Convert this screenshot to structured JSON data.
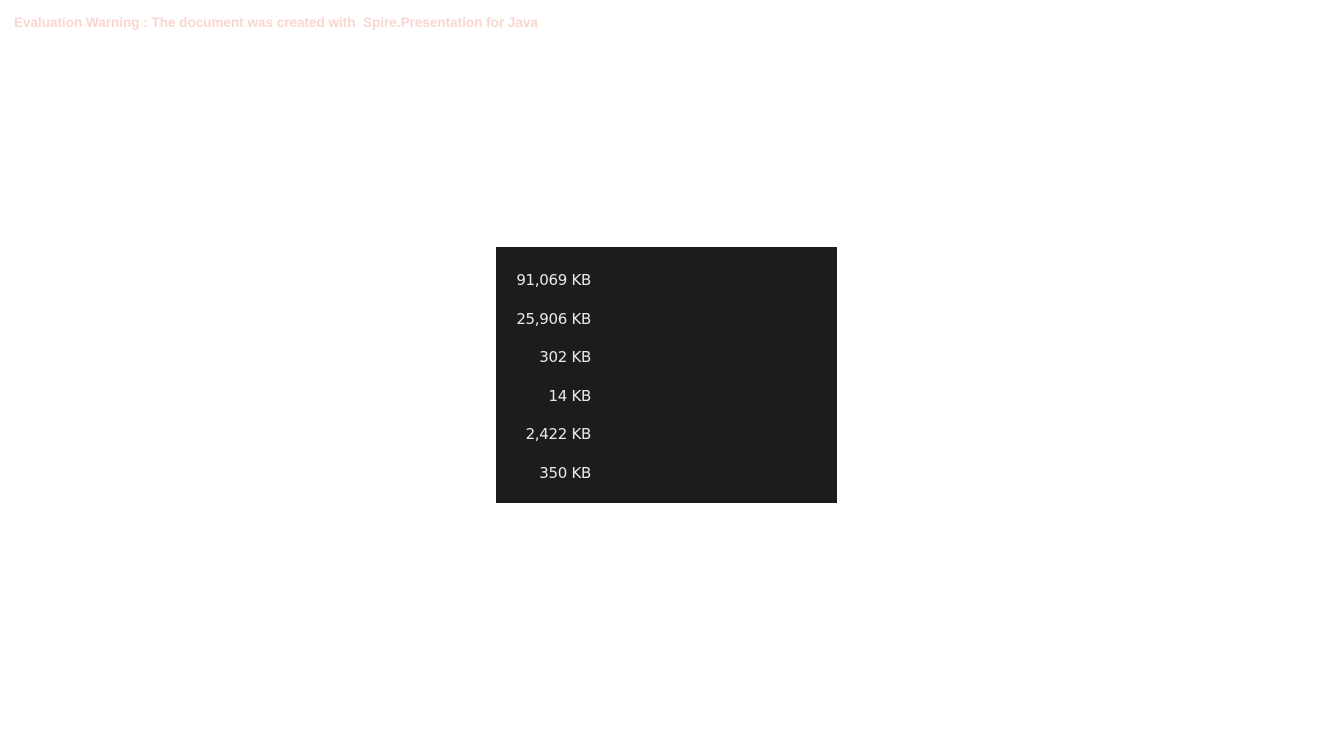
{
  "watermark": {
    "text": "Evaluation Warning : The document was created with  Spire.Presentation for Java"
  },
  "size_list": {
    "items": [
      "91,069 KB",
      "25,906 KB",
      "302 KB",
      "14 KB",
      "2,422 KB",
      "350 KB"
    ]
  },
  "colors": {
    "panel_background": "#1c1c1c",
    "panel_text": "#e9e9e9",
    "watermark_text": "#fbd6d0"
  }
}
